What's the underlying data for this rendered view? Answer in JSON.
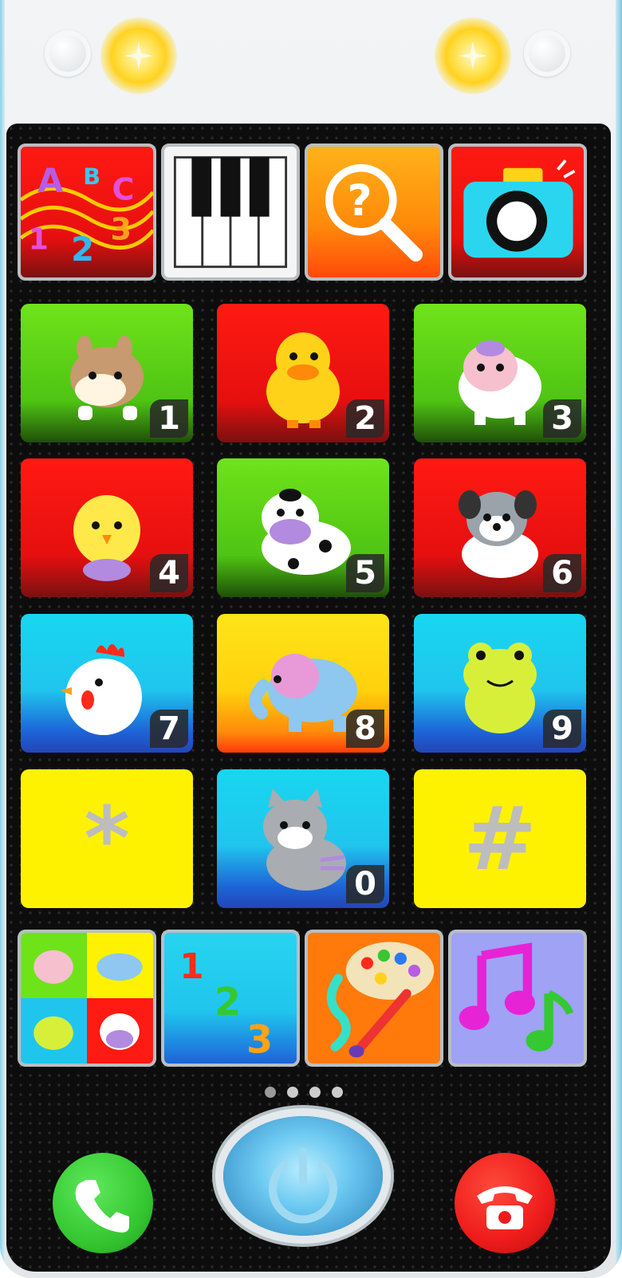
{
  "app": {
    "title": ""
  },
  "top_bar": {
    "left_button_icon": "speaker-button",
    "left_light_icon": "yellow-light-sparkle",
    "right_light_icon": "yellow-light-sparkle",
    "right_button_icon": "speaker-button"
  },
  "apps_row": [
    {
      "id": "abc",
      "icon": "abc-123-music-icon",
      "color": "#ff1a12",
      "glyphs": [
        "A",
        "B",
        "C",
        "1",
        "2",
        "3"
      ]
    },
    {
      "id": "piano",
      "icon": "piano-keys-icon",
      "color": "#ffffff"
    },
    {
      "id": "search",
      "icon": "magnifier-question-icon",
      "color": "#ff8a00"
    },
    {
      "id": "camera",
      "icon": "camera-icon",
      "color": "#ff1a12"
    }
  ],
  "keypad": [
    {
      "key": "1",
      "animal": "horse",
      "bg": "green"
    },
    {
      "key": "2",
      "animal": "duck",
      "bg": "red"
    },
    {
      "key": "3",
      "animal": "sheep",
      "bg": "green"
    },
    {
      "key": "4",
      "animal": "chick",
      "bg": "red"
    },
    {
      "key": "5",
      "animal": "cow",
      "bg": "green"
    },
    {
      "key": "6",
      "animal": "dog",
      "bg": "red"
    },
    {
      "key": "7",
      "animal": "hen",
      "bg": "cyan"
    },
    {
      "key": "8",
      "animal": "elephant",
      "bg": "yellow-grad"
    },
    {
      "key": "9",
      "animal": "frog",
      "bg": "cyan"
    },
    {
      "key": "*",
      "animal": "",
      "bg": "yellow"
    },
    {
      "key": "0",
      "animal": "cat",
      "bg": "cyan"
    },
    {
      "key": "#",
      "animal": "",
      "bg": "yellow"
    }
  ],
  "bottom_apps": [
    {
      "id": "animals-grid",
      "icon": "animals-grid-icon"
    },
    {
      "id": "numbers",
      "icon": "numbers-123-icon",
      "glyphs": [
        "1",
        "2",
        "3"
      ]
    },
    {
      "id": "paint",
      "icon": "paint-palette-icon"
    },
    {
      "id": "music",
      "icon": "music-notes-icon"
    }
  ],
  "page_indicator": {
    "pages": 4,
    "active": 1
  },
  "controls": {
    "call_icon": "phone-call-icon",
    "power_icon": "power-icon",
    "hangup_icon": "phone-hangup-icon",
    "call_color": "#35c832",
    "hangup_color": "#ee1b1b",
    "power_color": "#5cb8e8"
  }
}
